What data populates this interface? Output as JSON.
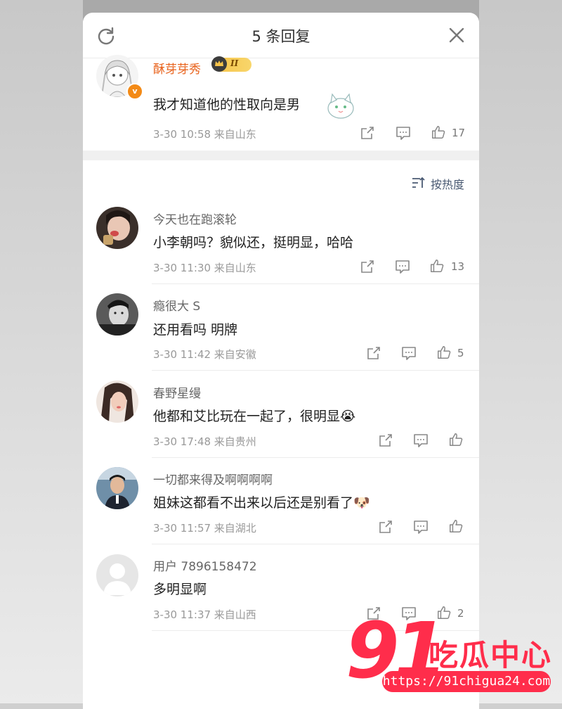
{
  "header": {
    "title": "5 条回复"
  },
  "root_comment": {
    "username": "酥芽芽秀",
    "level_badge": "II",
    "text": "我才知道他的性取向是男",
    "meta": "3-30 10:58  来自山东",
    "likes": "17"
  },
  "sort_label": "按热度",
  "replies": [
    {
      "username": "今天也在跑滚轮",
      "text": "小李朝吗？貌似还，挺明显，哈哈",
      "meta": "3-30 11:30  来自山东",
      "likes": "13"
    },
    {
      "username": "瘾很大 S",
      "text": "还用看吗 明牌",
      "meta": "3-30 11:42  来自安徽",
      "likes": "5"
    },
    {
      "username": "春野星缦",
      "text": "他都和艾比玩在一起了，很明显",
      "emoji": "😭",
      "meta": "3-30 17:48  来自贵州",
      "likes": ""
    },
    {
      "username": "一切都来得及啊啊啊啊",
      "text": "姐妹这都看不出来以后还是别看了",
      "emoji": "🐶",
      "meta": "3-30 11:57  来自湖北",
      "likes": ""
    },
    {
      "username": "用户 7896158472",
      "text": "多明显啊",
      "meta": "3-30 11:37  来自山西",
      "likes": "2"
    }
  ],
  "watermark": {
    "number": "91",
    "text": "吃瓜中心",
    "url": "https://91chigua24.com"
  },
  "colors": {
    "accent_orange": "#e8611a",
    "sort_blue": "#4a5a73",
    "watermark_red": "#ff2d4b",
    "vip_gold": "#f6c34a"
  }
}
